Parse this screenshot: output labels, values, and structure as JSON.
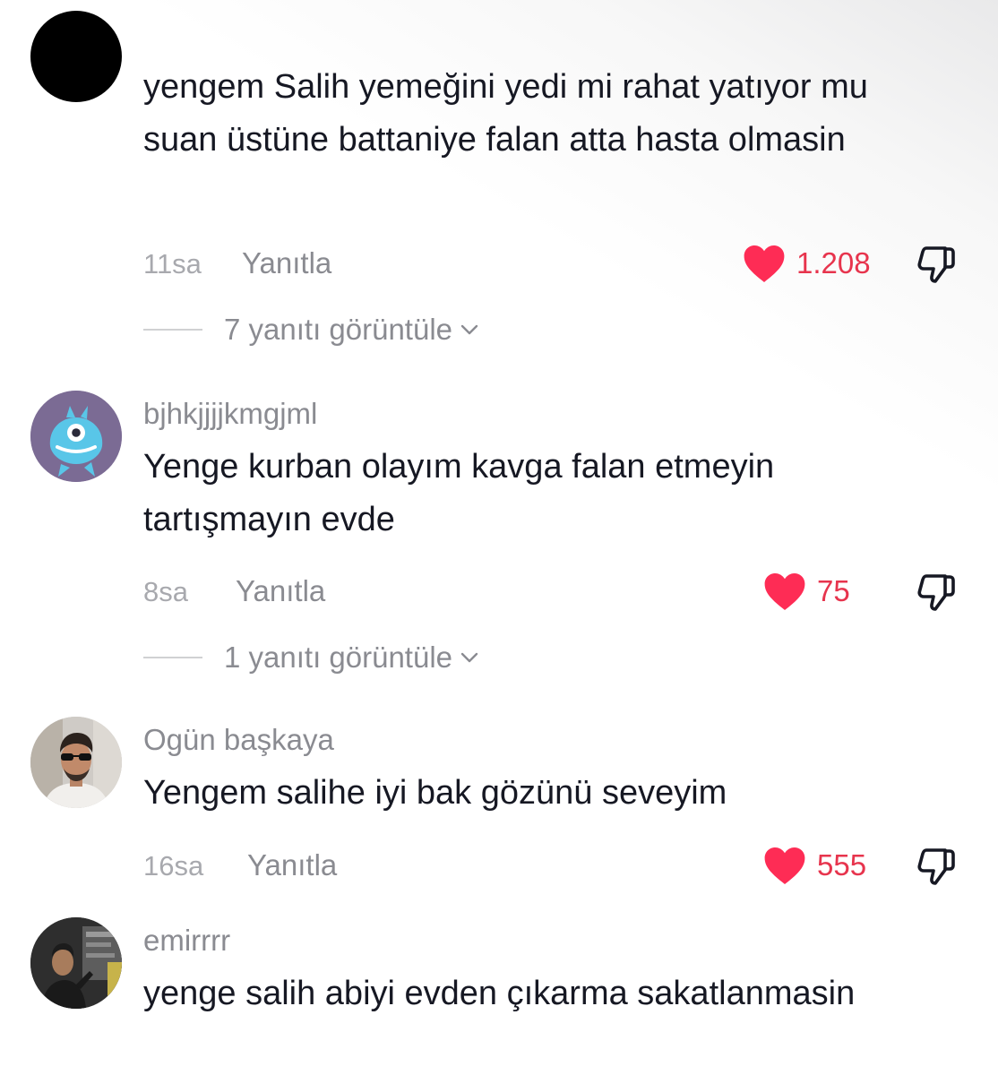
{
  "comments": [
    {
      "username": "",
      "text": "yengem Salih yemeğini yedi mi rahat yatıyor mu suan üstüne battaniye falan atta hasta olmasin",
      "time": "11sa",
      "reply_label": "Yanıtla",
      "likes": "1.208",
      "view_replies": "7 yanıtı görüntüle",
      "avatar_icon": "black-circle-avatar"
    },
    {
      "username": "bjhkjjjjkmgjml",
      "text": "Yenge kurban olayım kavga falan etmeyin tartışmayın evde",
      "time": "8sa",
      "reply_label": "Yanıtla",
      "likes": "75",
      "view_replies": "1 yanıtı görüntüle",
      "avatar_icon": "monster-avatar"
    },
    {
      "username": "Ogün başkaya",
      "text": "Yengem salihe iyi bak gözünü seveyim",
      "time": "16sa",
      "reply_label": "Yanıtla",
      "likes": "555",
      "avatar_icon": "user-photo-avatar"
    },
    {
      "username": "emirrrr",
      "text": "yenge salih abiyi evden çıkarma sakatlanmasin",
      "avatar_icon": "user-photo-avatar"
    }
  ],
  "icons": {
    "like": "heart-icon",
    "dislike": "thumbs-down-icon",
    "expand": "chevron-down-icon"
  },
  "colors": {
    "like_active": "#fe2c55",
    "like_count": "#e7344d",
    "secondary_text": "#8a8b91",
    "primary_text": "#161823"
  }
}
